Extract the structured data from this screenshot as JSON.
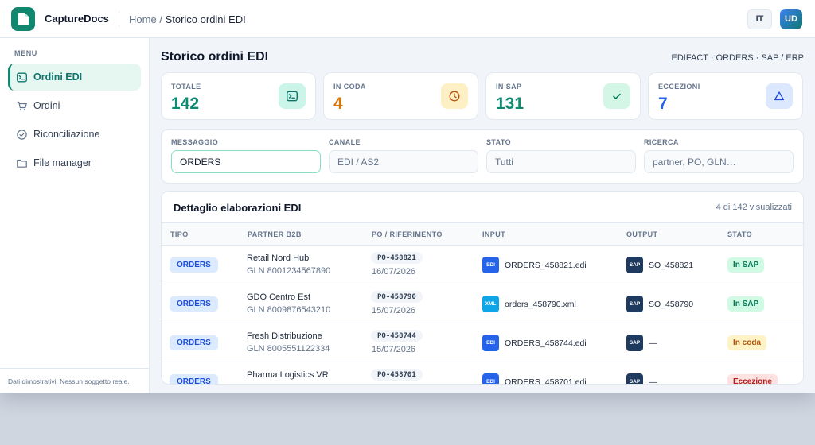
{
  "app": {
    "brand": "CaptureDocs"
  },
  "breadcrumb": {
    "home": "Home",
    "separator": "/",
    "current": "Storico ordini EDI"
  },
  "topbar": {
    "language": "IT",
    "user_initials": "UD"
  },
  "sidebar": {
    "menu_title": "MENU",
    "items": [
      {
        "label": "Ordini EDI",
        "icon": "terminal-icon",
        "active": true
      },
      {
        "label": "Ordini",
        "icon": "cart-icon",
        "active": false
      },
      {
        "label": "Riconciliazione",
        "icon": "check-circle-icon",
        "active": false
      },
      {
        "label": "File manager",
        "icon": "folder-icon",
        "active": false
      }
    ],
    "footer": "Dati dimostrativi. Nessun soggetto reale."
  },
  "page": {
    "title": "Storico ordini EDI",
    "subtitle": "EDIFACT · ORDERS · SAP / ERP"
  },
  "stats": [
    {
      "label": "TOTALE",
      "value": "142",
      "color": "#0f8a70",
      "icon": "terminal-icon",
      "icon_bg": "#ccf5e9"
    },
    {
      "label": "IN CODA",
      "value": "4",
      "color": "#d97706",
      "icon": "clock-icon",
      "icon_bg": "#fdf0c4"
    },
    {
      "label": "IN SAP",
      "value": "131",
      "color": "#0f8a70",
      "icon": "check-icon",
      "icon_bg": "#d3f6e6"
    },
    {
      "label": "ECCEZIONI",
      "value": "7",
      "color": "#2563eb",
      "icon": "warning-icon",
      "icon_bg": "#dbe8fd"
    }
  ],
  "filters": {
    "messaggio": {
      "label": "MESSAGGIO",
      "value": "ORDERS"
    },
    "canale": {
      "label": "CANALE",
      "value": "EDI / AS2"
    },
    "stato": {
      "label": "STATO",
      "value": "Tutti"
    },
    "ricerca": {
      "label": "RICERCA",
      "placeholder": "partner, PO, GLN…"
    }
  },
  "table": {
    "title": "Dettaglio elaborazioni EDI",
    "count": "4 di 142 visualizzati",
    "headers": {
      "tipo": "TIPO",
      "partner": "PARTNER B2B",
      "po": "PO / RIFERIMENTO",
      "input": "INPUT",
      "output": "OUTPUT",
      "stato": "STATO"
    },
    "rows": [
      {
        "tipo": "ORDERS",
        "partner": "Retail Nord Hub",
        "gln": "GLN 8001234567890",
        "po": "PO-458821",
        "date": "16/07/2026",
        "input_type": "EDI",
        "input_file": "ORDERS_458821.edi",
        "output_type": "SAP",
        "output": "SO_458821",
        "stato": "In SAP",
        "stato_kind": "ok"
      },
      {
        "tipo": "ORDERS",
        "partner": "GDO Centro Est",
        "gln": "GLN 8009876543210",
        "po": "PO-458790",
        "date": "15/07/2026",
        "input_type": "XML",
        "input_file": "orders_458790.xml",
        "output_type": "SAP",
        "output": "SO_458790",
        "stato": "In SAP",
        "stato_kind": "ok"
      },
      {
        "tipo": "ORDERS",
        "partner": "Fresh Distribuzione",
        "gln": "GLN 8005551122334",
        "po": "PO-458744",
        "date": "15/07/2026",
        "input_type": "EDI",
        "input_file": "ORDERS_458744.edi",
        "output_type": "SAP",
        "output": "—",
        "stato": "In coda",
        "stato_kind": "queue"
      },
      {
        "tipo": "ORDERS",
        "partner": "Pharma Logistics VR",
        "gln": "",
        "po": "PO-458701",
        "date": "",
        "input_type": "EDI",
        "input_file": "ORDERS_458701.edi",
        "output_type": "SAP",
        "output": "—",
        "stato": "Eccezione",
        "stato_kind": "error"
      }
    ]
  },
  "colors": {
    "brand": "#12876f",
    "edi_icon": "#2563eb",
    "xml_icon": "#0ea5e9",
    "sap_icon": "#1e3a5f",
    "ok_bg": "#d1fae5",
    "ok_fg": "#047857",
    "queue_bg": "#fef3c7",
    "queue_fg": "#b45309",
    "error_bg": "#fee2e2",
    "error_fg": "#b91c1c"
  }
}
